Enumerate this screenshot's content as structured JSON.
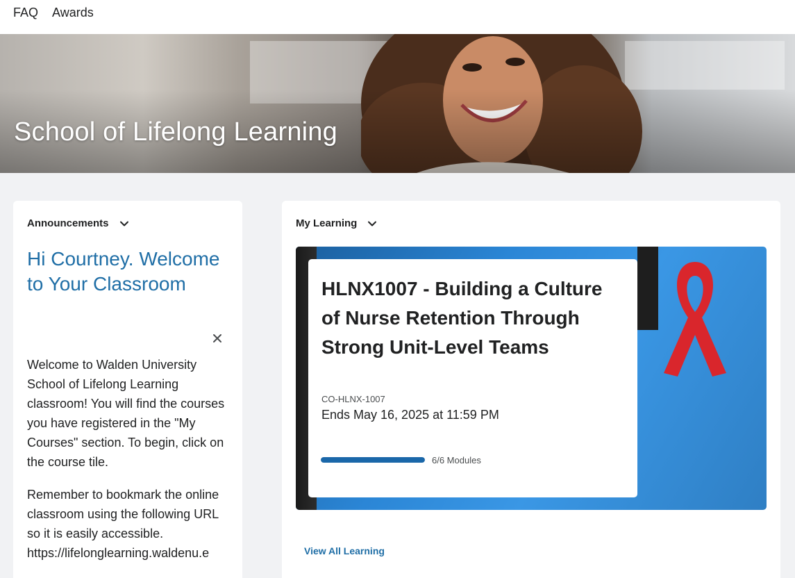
{
  "topnav": {
    "items": [
      "FAQ",
      "Awards"
    ]
  },
  "hero": {
    "title": "School of Lifelong Learning"
  },
  "announcements": {
    "heading": "Announcements",
    "greeting": "Hi Courtney. Welcome to Your Classroom",
    "paragraph1": "Welcome to Walden University School of Lifelong Learning classroom! You will find the courses you have registered in the \"My Courses\" section. To begin, click on the course tile.",
    "paragraph2": "Remember to bookmark the online classroom using the following URL so it is easily accessible.",
    "url": "https://lifelonglearning.waldenu.e"
  },
  "my_learning": {
    "heading": "My Learning",
    "course": {
      "title": "HLNX1007 - Building a Culture of Nurse Retention Through Strong Unit-Level Teams",
      "code": "CO-HLNX-1007",
      "ends": "Ends May 16, 2025 at 11:59 PM",
      "progress_fraction": 1.0,
      "modules_label": "6/6 Modules"
    },
    "view_all": "View All Learning"
  },
  "colors": {
    "accent": "#1f6ea6",
    "progress": "#1a67a9",
    "tile_blue": "#2b86d6",
    "ribbon": "#d9262c"
  },
  "icons": {
    "panel_toggle": "chevron-down-icon",
    "dismiss": "close-icon"
  }
}
